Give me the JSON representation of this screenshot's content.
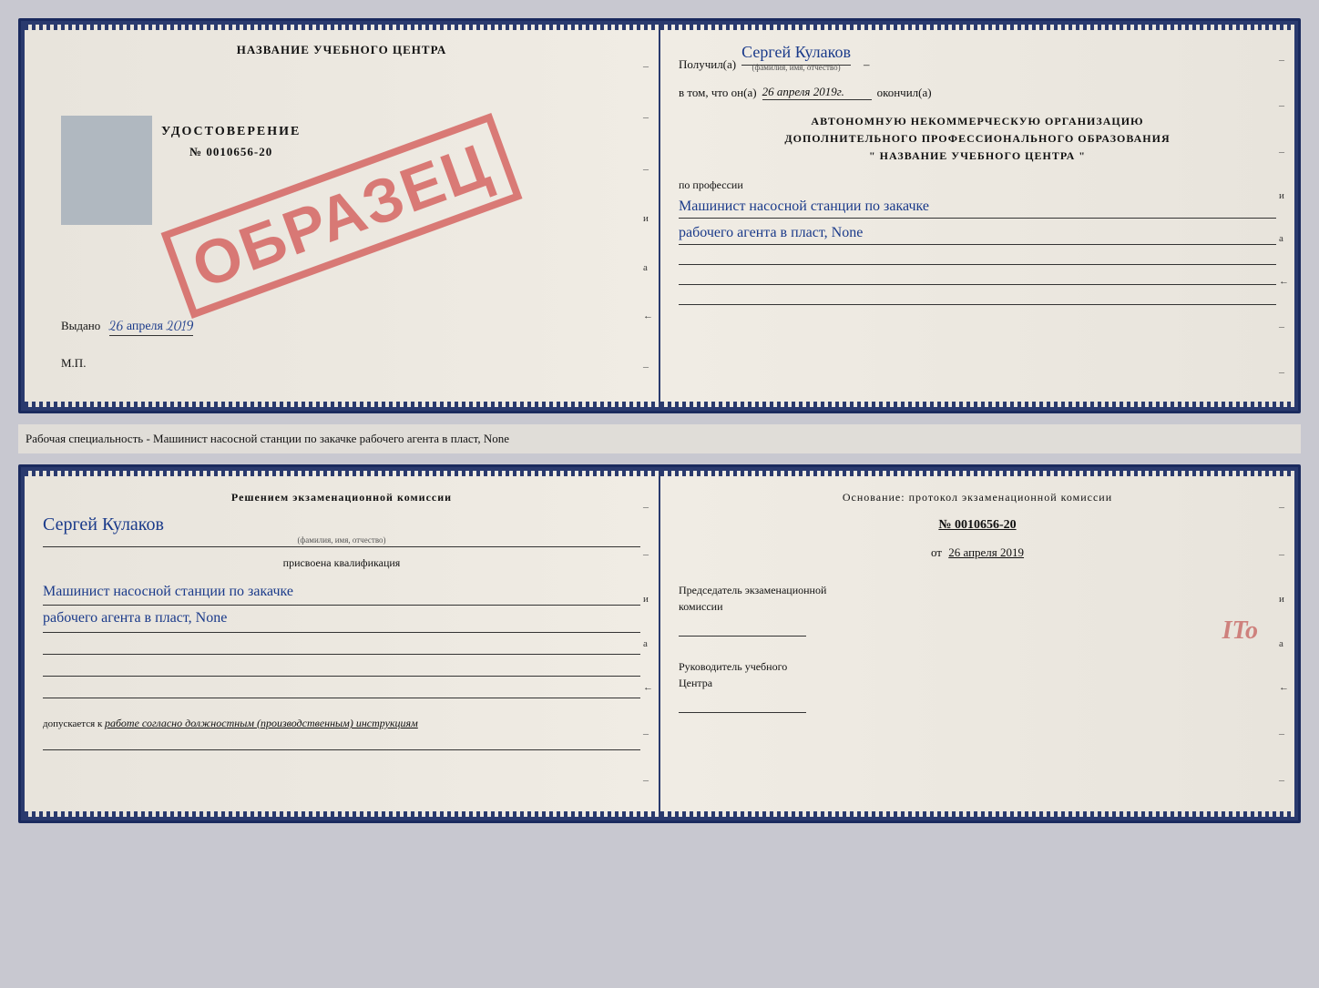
{
  "document": {
    "top_spread": {
      "left_page": {
        "center_title": "НАЗВАНИЕ УЧЕБНОГО ЦЕНТРА",
        "udostoverenie_label": "УДОСТОВЕРЕНИЕ",
        "number": "№ 0010656-20",
        "stamp_text": "ОБРАЗЕЦ",
        "vydano_label": "Выдано",
        "vydano_date": "26 апреля 2019",
        "mp_label": "М.П."
      },
      "right_page": {
        "poluchil_label": "Получил(а)",
        "recipient_name": "Сергей Кулаков",
        "name_sub": "(фамилия, имя, отчество)",
        "vtom_label": "в том, что он(а)",
        "date_value": "26 апреля 2019г.",
        "okonchil_label": "окончил(а)",
        "org_line1": "АВТОНОМНУЮ НЕКОММЕРЧЕСКУЮ ОРГАНИЗАЦИЮ",
        "org_line2": "ДОПОЛНИТЕЛЬНОГО ПРОФЕССИОНАЛЬНОГО ОБРАЗОВАНИЯ",
        "org_line3": "\"  НАЗВАНИЕ УЧЕБНОГО ЦЕНТРА  \"",
        "po_professii": "по профессии",
        "profession_line1": "Машинист насосной станции по закачке",
        "profession_line2": "рабочего агента в пласт, None"
      }
    },
    "below_text": "Рабочая специальность - Машинист насосной станции по закачке рабочего агента в пласт,\nNone",
    "bottom_spread": {
      "left_page": {
        "reshenie_text": "Решением  экзаменационной  комиссии",
        "person_name": "Сергей Кулаков",
        "name_sub": "(фамилия, имя, отчество)",
        "prisvoena_label": "присвоена квалификация",
        "qualif_line1": "Машинист насосной станции по закачке",
        "qualif_line2": "рабочего агента в пласт, None",
        "dopuskaetsya_label": "допускается к",
        "dopuskaetsya_text": "работе согласно должностным (производственным) инструкциям"
      },
      "right_page": {
        "osnovanie_label": "Основание: протокол экзаменационной  комиссии",
        "protocol_num": "№  0010656-20",
        "date_label": "от",
        "date_value": "26 апреля 2019",
        "predsedatel_label": "Председатель экзаменационной",
        "predsedatel_label2": "комиссии",
        "rukovoditel_label": "Руководитель учебного",
        "rukovoditel_label2": "Центра"
      }
    }
  }
}
